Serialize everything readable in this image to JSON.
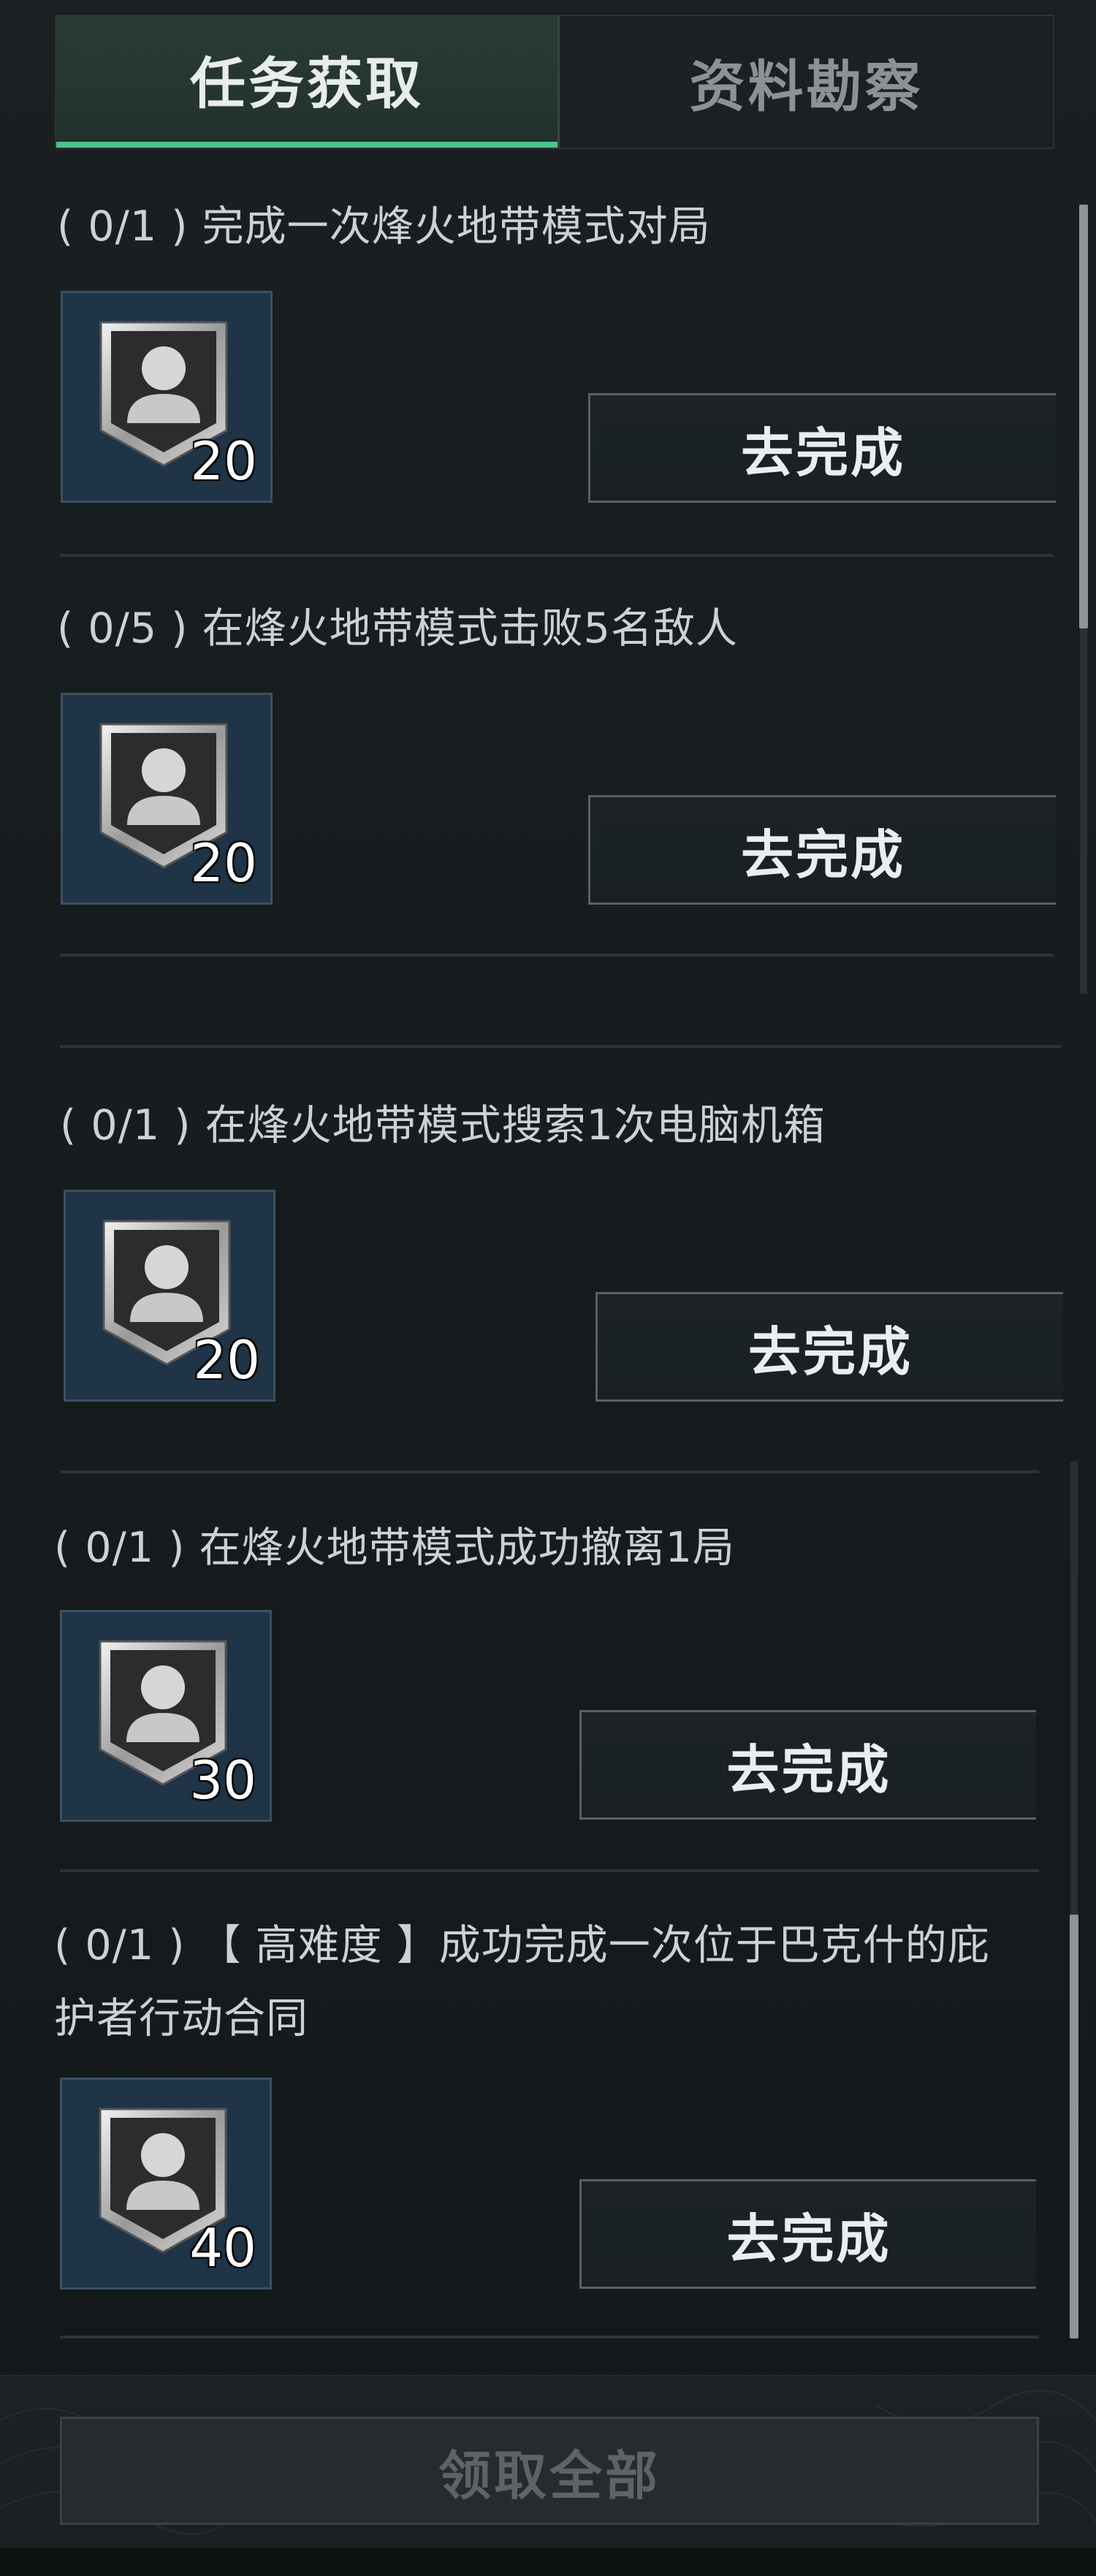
{
  "tabs": [
    {
      "label": "任务获取"
    },
    {
      "label": "资料勘察"
    }
  ],
  "tasks": [
    {
      "title": "( 0/1 ) 完成一次烽火地带模式对局",
      "reward_count": "20",
      "button": "去完成"
    },
    {
      "title": "( 0/5 ) 在烽火地带模式击败5名敌人",
      "reward_count": "20",
      "button": "去完成"
    },
    {
      "title": "( 0/1 ) 在烽火地带模式搜索1次电脑机箱",
      "reward_count": "20",
      "button": "去完成"
    },
    {
      "title": "( 0/1 ) 在烽火地带模式成功撤离1局",
      "reward_count": "30",
      "button": "去完成"
    },
    {
      "title": "( 0/1 ) 【 高难度 】成功完成一次位于巴克什的庇护者行动合同",
      "reward_count": "40",
      "button": "去完成"
    }
  ],
  "footer": {
    "claim_all": "领取全部"
  },
  "colors": {
    "accent": "#49c48a",
    "reward_bg": "#1f3446"
  },
  "icons": {
    "reward": "avatar-badge-icon"
  }
}
